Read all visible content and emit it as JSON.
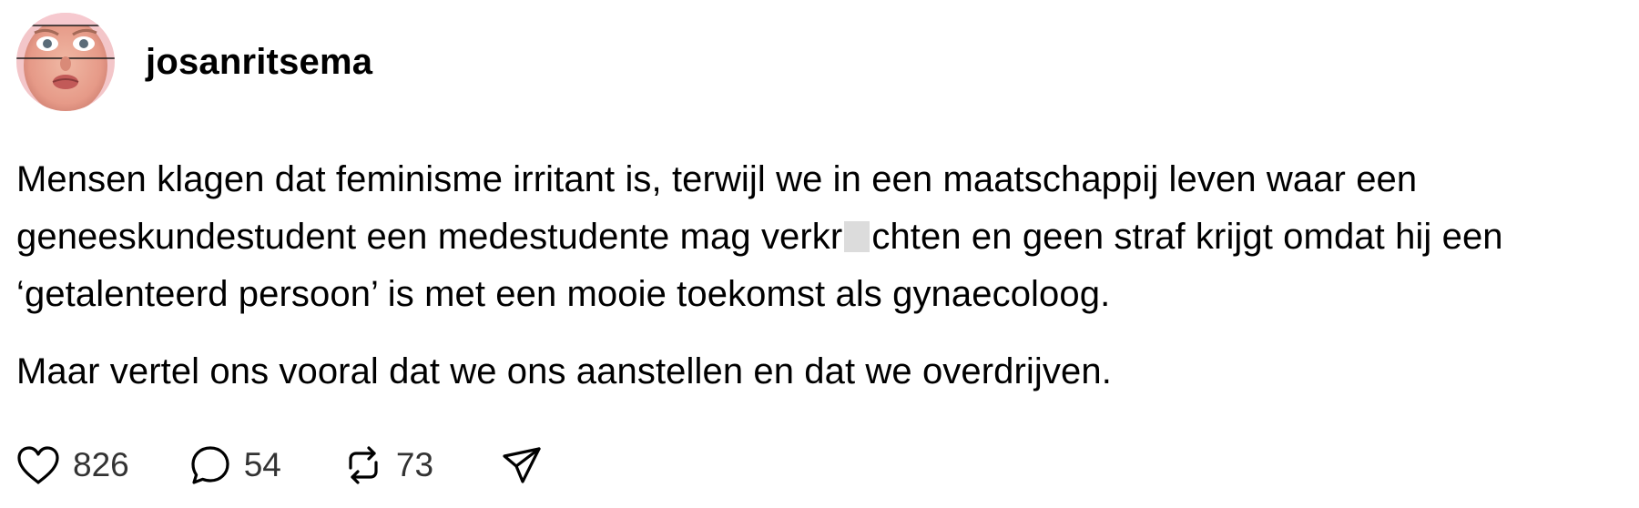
{
  "post": {
    "author": {
      "username": "josanritsema"
    },
    "paragraphs": {
      "p1_part1": "Mensen klagen dat feminisme irritant is, terwijl we in een maatschappij leven waar een geneeskundestudent een medestudente mag verkr",
      "p1_part2": "chten en geen straf krijgt omdat hij een ‘getalenteerd persoon’ is met een mooie toekomst als gynaecoloog.",
      "p2": "Maar vertel ons vooral dat we ons aanstellen en dat we overdrijven."
    },
    "actions": {
      "likes": "826",
      "replies": "54",
      "reposts": "73"
    },
    "icons": {
      "like": "heart-icon",
      "reply": "speech-bubble-icon",
      "repost": "repost-icon",
      "share": "send-icon"
    },
    "colors": {
      "text": "#000000",
      "count": "#333333",
      "censor": "#dcdcdc"
    }
  }
}
